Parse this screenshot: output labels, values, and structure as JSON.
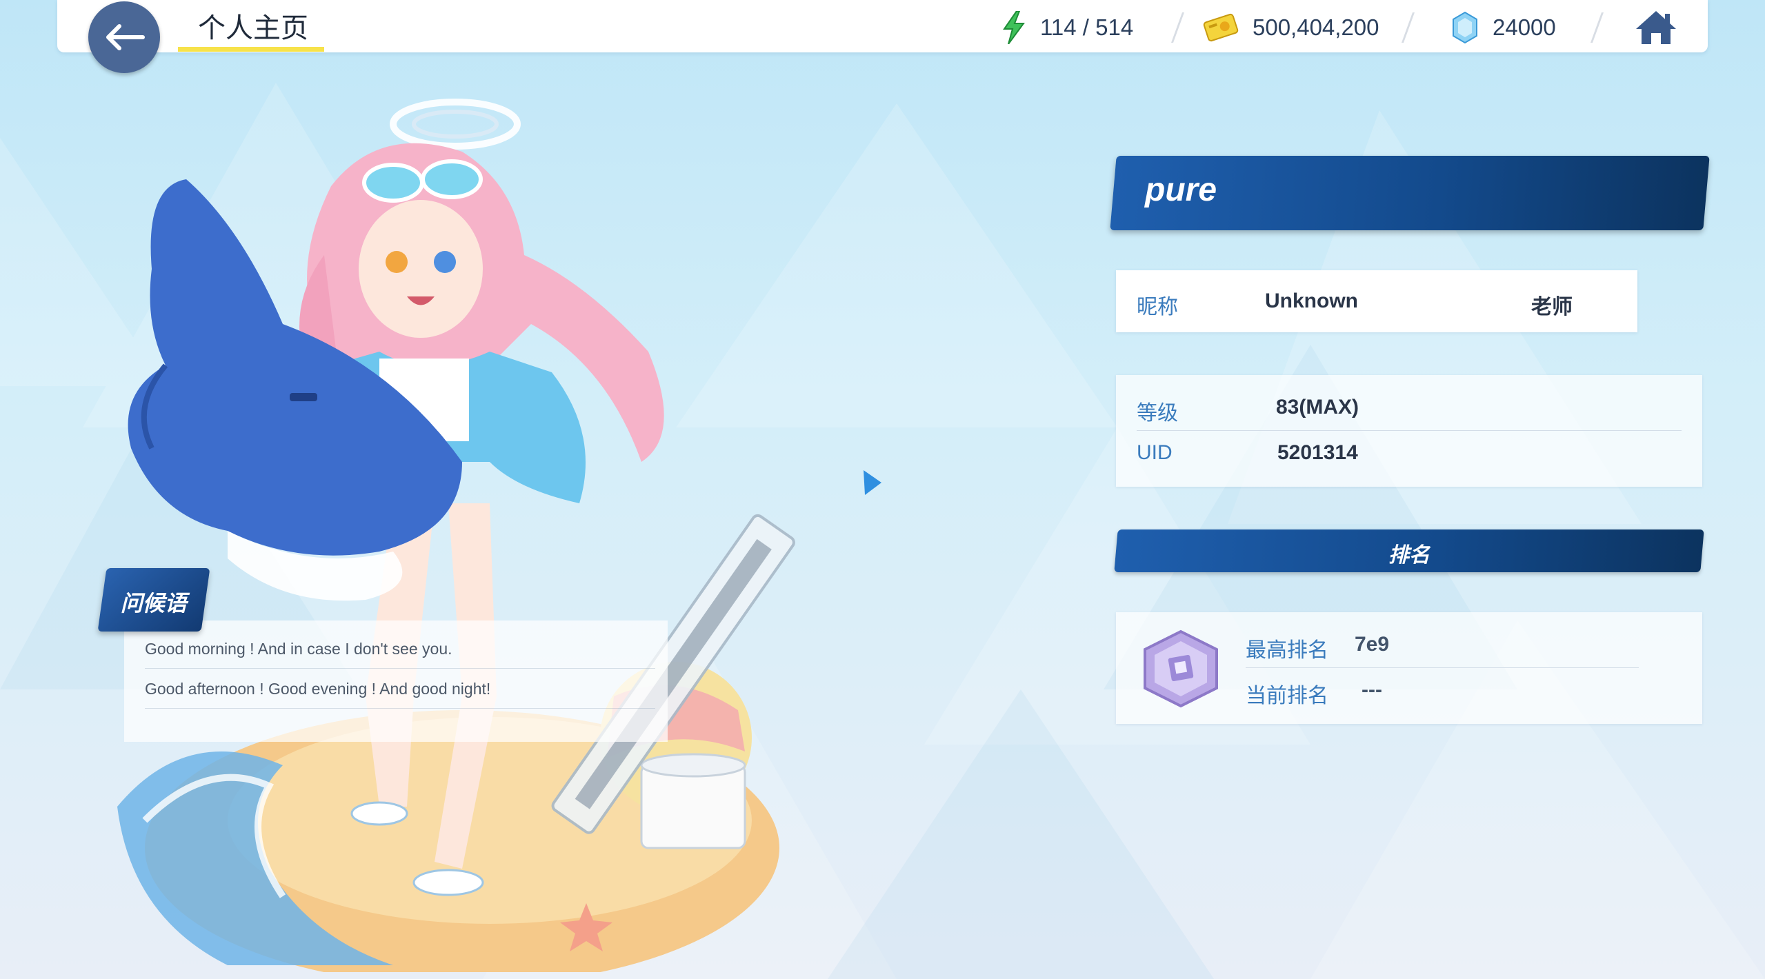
{
  "header": {
    "title": "个人主页",
    "stamina": "114 / 514",
    "credits": "500,404,200",
    "gems": "24000"
  },
  "profile": {
    "name": "pure",
    "nickname_label": "昵称",
    "nickname_value": "Unknown",
    "nickname_suffix": "老师",
    "level_label": "等级",
    "level_value": "83(MAX)",
    "uid_label": "UID",
    "uid_value": "5201314"
  },
  "greeting": {
    "tag": "问候语",
    "lines": [
      "Good morning ! And in case I don't see you.",
      "Good afternoon ! Good evening ! And good night!"
    ]
  },
  "ranking": {
    "title": "排名",
    "best_label": "最高排名",
    "best_value": "7e9",
    "current_label": "当前排名",
    "current_value": "---"
  },
  "colors": {
    "banner_start": "#1f5fae",
    "banner_end": "#0c335f",
    "label_blue": "#3a7bbd",
    "back_button": "#4a6796",
    "title_underline": "#f7e24a"
  },
  "icons": [
    "back-arrow-icon",
    "stamina-bolt-icon",
    "credit-card-icon",
    "gem-icon",
    "home-icon",
    "rank-badge-icon"
  ]
}
